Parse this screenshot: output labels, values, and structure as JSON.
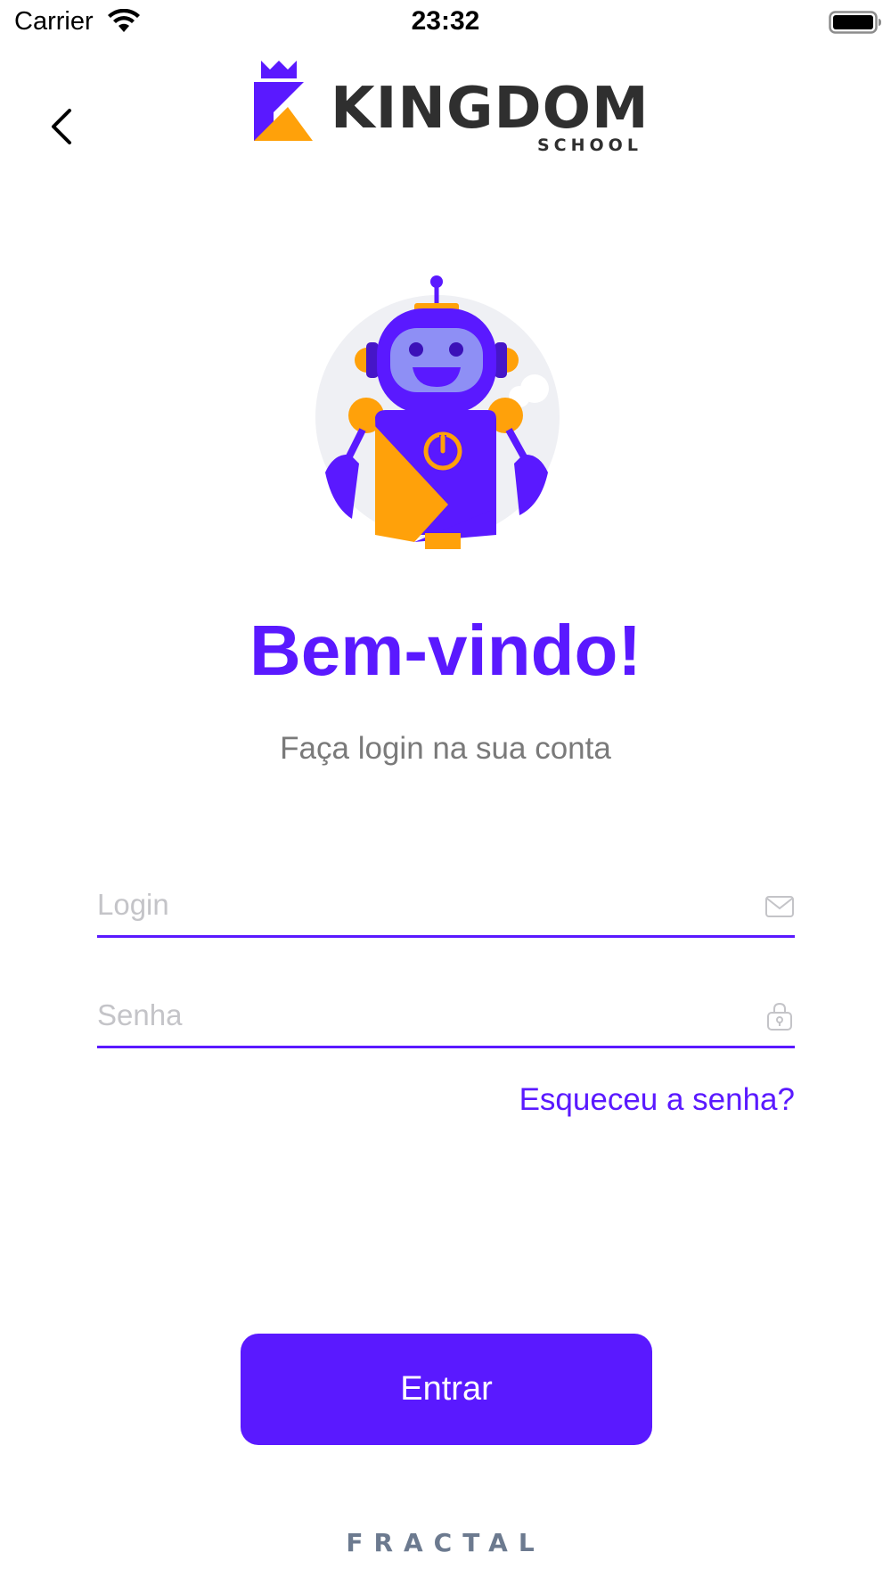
{
  "status_bar": {
    "carrier": "Carrier",
    "time": "23:32"
  },
  "header": {
    "logo_name": "KINGDOM",
    "logo_sub": "SCHOOL",
    "back_icon": "chevron-left-icon"
  },
  "main": {
    "title": "Bem-vindo!",
    "subtitle": "Faça login na sua conta",
    "login_placeholder": "Login",
    "login_icon": "mail-icon",
    "senha_placeholder": "Senha",
    "senha_icon": "lock-icon",
    "forgot_label": "Esqueceu a senha?",
    "enter_label": "Entrar"
  },
  "footer": {
    "brand": "FRACTAL"
  },
  "colors": {
    "accent": "#5a19ff",
    "orange": "#ffa10a",
    "subtitle": "#7a7a7a",
    "placeholder": "#c4c4c8"
  }
}
